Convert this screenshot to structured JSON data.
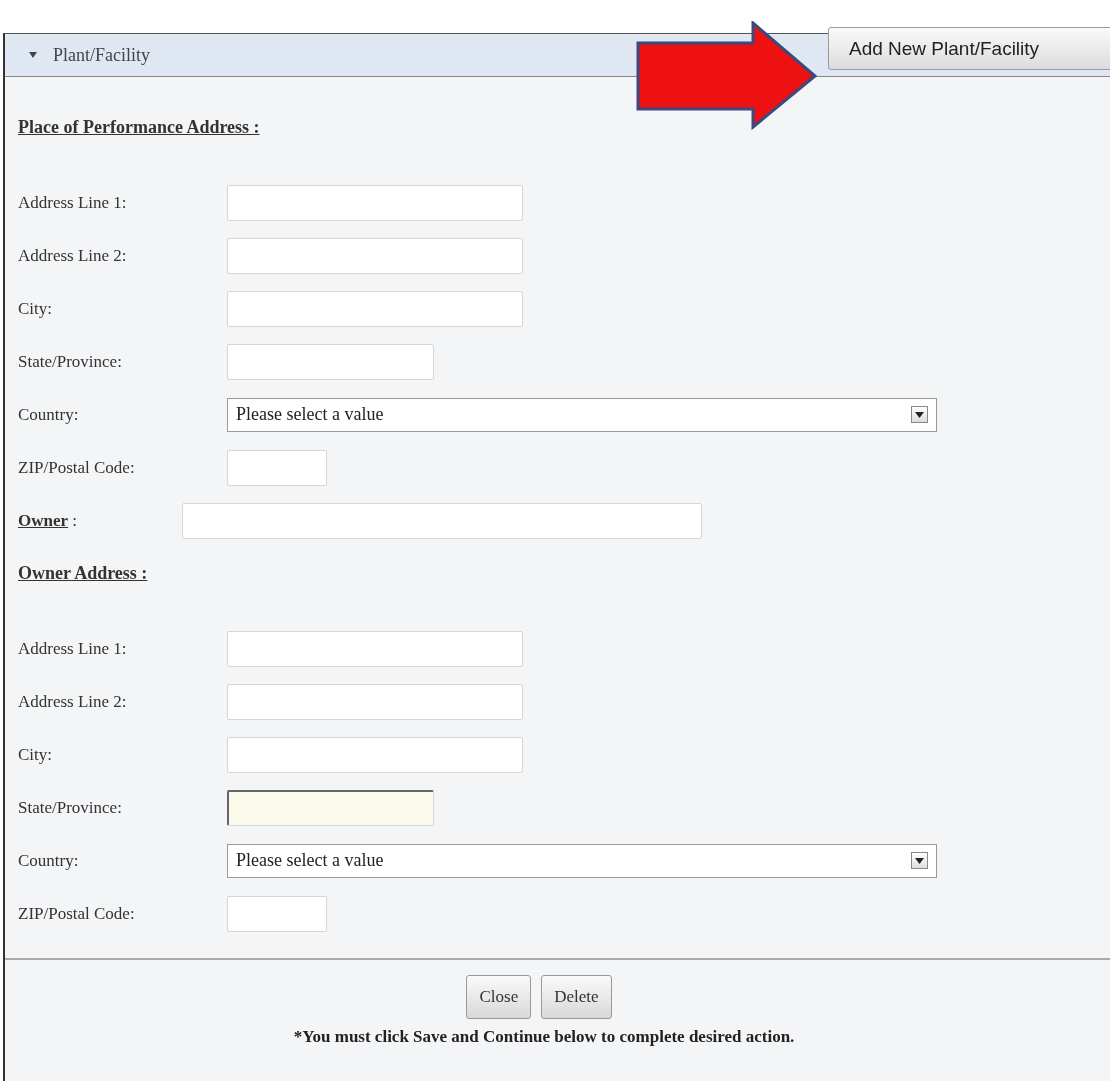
{
  "panel": {
    "title": "Plant/Facility",
    "expanded": true
  },
  "add_button": "Add New Plant/Facility",
  "sections": [
    {
      "heading": "Place of Performance Address :",
      "fields": [
        {
          "kind": "long",
          "label": "Address Line 1:",
          "focused": false
        },
        {
          "kind": "long",
          "label": "Address Line 2:",
          "focused": false
        },
        {
          "kind": "long",
          "label": "City:",
          "focused": false
        },
        {
          "kind": "medium",
          "label": "State/Province:",
          "focused": false
        },
        {
          "kind": "select",
          "label": "Country:",
          "value": "Please select a value"
        },
        {
          "kind": "short",
          "label": "ZIP/Postal Code:",
          "focused": false
        },
        {
          "kind": "owner",
          "label": "**Owner** :",
          "focused": false
        }
      ]
    },
    {
      "heading": "Owner Address :",
      "fields": [
        {
          "kind": "long",
          "label": "Address Line 1:",
          "focused": false
        },
        {
          "kind": "long",
          "label": "Address Line 2:",
          "focused": false
        },
        {
          "kind": "long",
          "label": "City:",
          "focused": false
        },
        {
          "kind": "medium",
          "label": "State/Province:",
          "focused": true
        },
        {
          "kind": "select",
          "label": "Country:",
          "value": "Please select a value"
        },
        {
          "kind": "short",
          "label": "ZIP/Postal Code:",
          "focused": false
        }
      ]
    }
  ],
  "buttons": [
    "Close",
    "Delete"
  ],
  "footnote": "*You must click Save and Continue below to complete desired action."
}
